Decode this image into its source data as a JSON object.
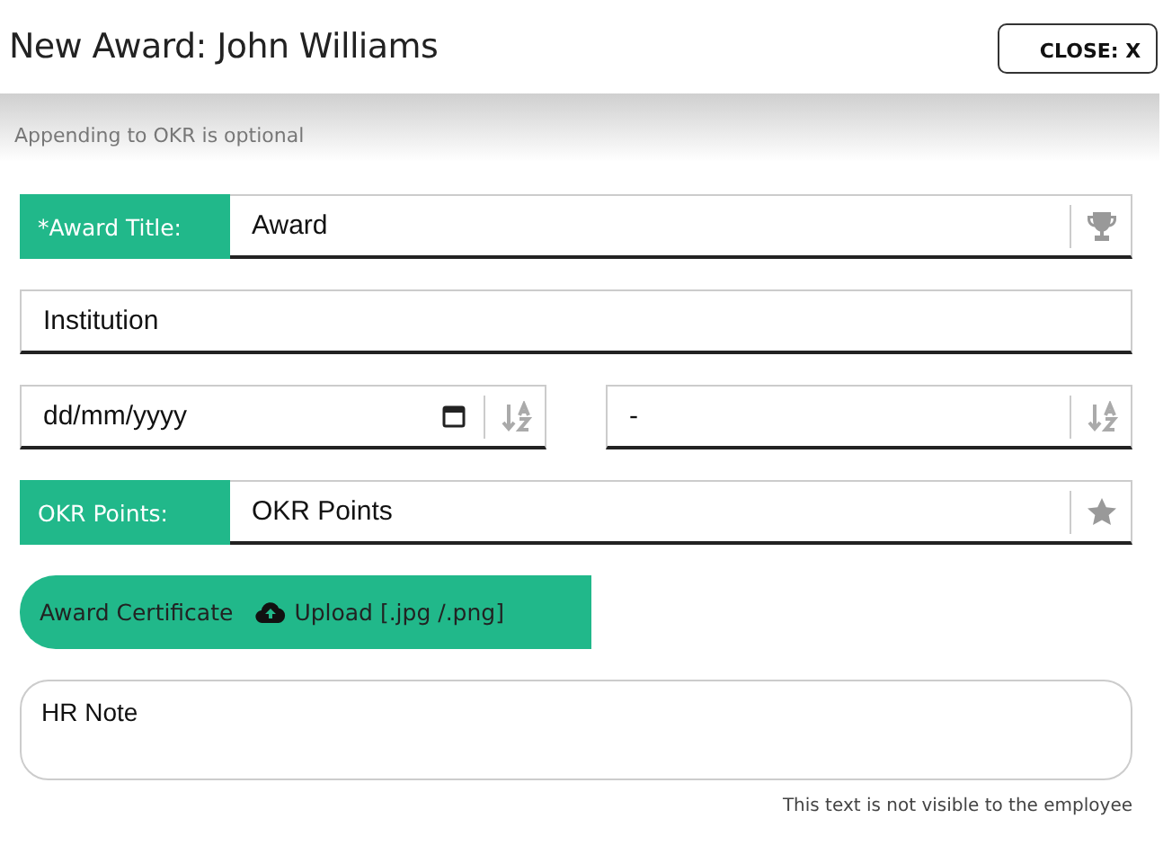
{
  "dialog": {
    "title": "New Award: John Williams",
    "close_button": "CLOSE: X"
  },
  "hint": "Appending to OKR is optional",
  "award_title": {
    "label": "*Award Title:",
    "placeholder": "Award"
  },
  "institution": {
    "placeholder": "Institution"
  },
  "date": {
    "placeholder": "dd/mm/yyyy"
  },
  "select": {
    "value": "-"
  },
  "okr_points": {
    "label": "OKR Points:",
    "placeholder": "OKR Points"
  },
  "certificate": {
    "label": "Award Certificate",
    "button": "Upload [.jpg /.png]"
  },
  "hr_note": {
    "placeholder": "HR Note",
    "note": "This text is not visible to the employee"
  }
}
